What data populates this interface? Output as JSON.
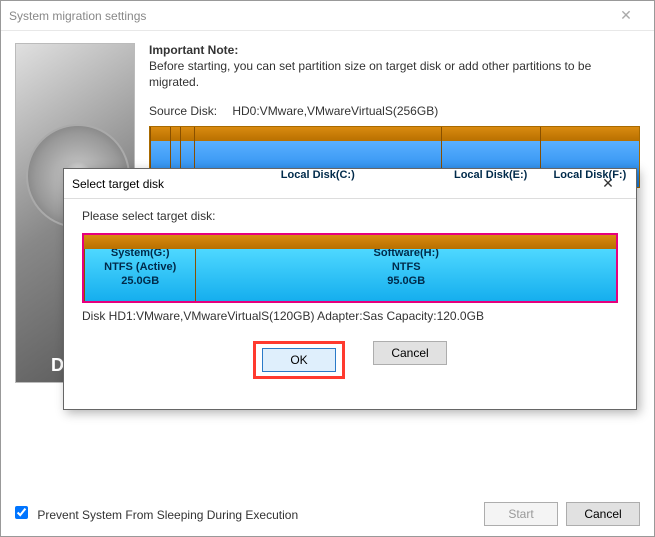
{
  "main": {
    "title": "System migration settings",
    "note_title": "Important Note:",
    "note_text": "Before starting, you can set partition size on target disk or add other partitions to be migrated.",
    "source_label": "Source Disk:",
    "source_value": "HD0:VMware,VMwareVirtualS(256GB)",
    "partitions": [
      {
        "label": "Local Disk(C:)"
      },
      {
        "label": "Local Disk(E:)"
      },
      {
        "label": "Local Disk(F:)"
      }
    ],
    "prevent_sleep_label": "Prevent System From Sleeping During Execution",
    "start_label": "Start",
    "cancel_label": "Cancel"
  },
  "modal": {
    "title": "Select target disk",
    "prompt": "Please select target disk:",
    "partitions": [
      {
        "name": "System(G:)",
        "fs": "NTFS (Active)",
        "size": "25.0GB"
      },
      {
        "name": "Software(H:)",
        "fs": "NTFS",
        "size": "95.0GB"
      }
    ],
    "disk_info": "Disk HD1:VMware,VMwareVirtualS(120GB)  Adapter:Sas  Capacity:120.0GB",
    "ok_label": "OK",
    "cancel_label": "Cancel"
  }
}
